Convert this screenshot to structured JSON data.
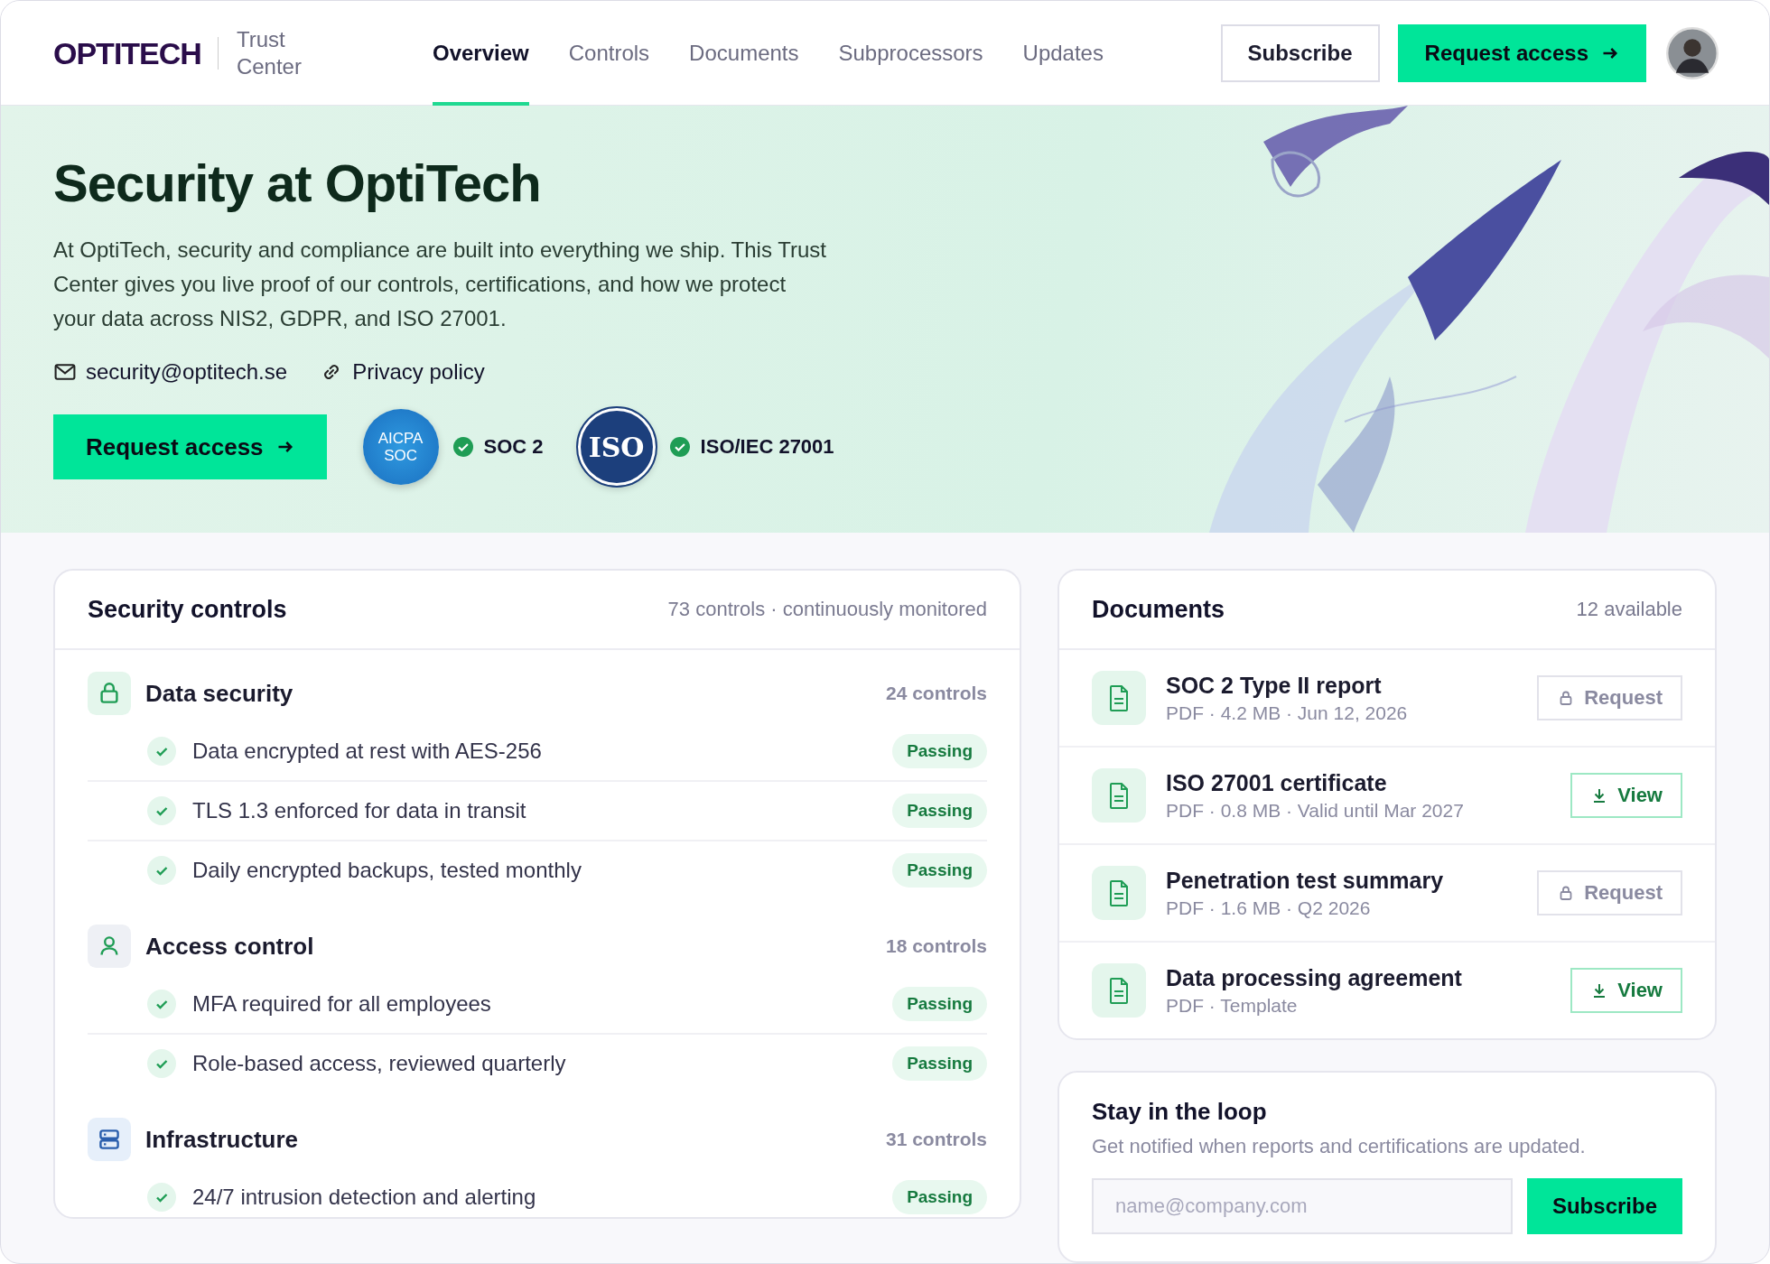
{
  "header": {
    "logo": "OPTITECH",
    "product": "Trust Center",
    "nav": [
      {
        "label": "Overview",
        "selected": true
      },
      {
        "label": "Controls",
        "selected": false
      },
      {
        "label": "Documents",
        "selected": false
      },
      {
        "label": "Subprocessors",
        "selected": false
      },
      {
        "label": "Updates",
        "selected": false
      }
    ],
    "subscribe": "Subscribe",
    "request": "Request access"
  },
  "hero": {
    "title": "Security at OptiTech",
    "description": "At OptiTech, security and compliance are built into everything we ship. This Trust Center gives you live proof of our controls, certifications, and how we protect your data across NIS2, GDPR, and ISO 27001.",
    "contacts": [
      {
        "kind": "email",
        "text": "security@optitech.se"
      },
      {
        "kind": "link",
        "text": "Privacy policy"
      }
    ],
    "cta": "Request access",
    "certifications": [
      {
        "kind": "soc",
        "logo_lines": [
          "AICPA",
          "SOC"
        ],
        "label": "SOC 2",
        "verified": true
      },
      {
        "kind": "iso",
        "logo_lines": [
          "ISO"
        ],
        "label": "ISO/IEC 27001",
        "verified": true
      }
    ]
  },
  "controls": {
    "title": "Security controls",
    "summary": "73 controls · continuously monitored",
    "groups": [
      {
        "kind": "lock",
        "name": "Data security",
        "count": "24 controls",
        "items": [
          {
            "text": "Data encrypted at rest with AES-256",
            "status": "Passing",
            "passing": true
          },
          {
            "text": "TLS 1.3 enforced for data in transit",
            "status": "Passing",
            "passing": true
          },
          {
            "text": "Daily encrypted backups, tested monthly",
            "status": "Passing",
            "passing": true
          }
        ]
      },
      {
        "kind": "user",
        "name": "Access control",
        "count": "18 controls",
        "items": [
          {
            "text": "MFA required for all employees",
            "status": "Passing",
            "passing": true
          },
          {
            "text": "Role-based access, reviewed quarterly",
            "status": "Passing",
            "passing": true
          }
        ]
      },
      {
        "kind": "server",
        "name": "Infrastructure",
        "count": "31 controls",
        "items": [
          {
            "text": "24/7 intrusion detection and alerting",
            "status": "Passing",
            "passing": true
          }
        ]
      }
    ]
  },
  "documents": {
    "title": "Documents",
    "count": "12 available",
    "items": [
      {
        "name": "SOC 2 Type II report",
        "meta": "PDF · 4.2 MB · Jun 12, 2026",
        "action": {
          "kind": "request",
          "label": "Request"
        }
      },
      {
        "name": "ISO 27001 certificate",
        "meta": "PDF · 0.8 MB · Valid until Mar 2027",
        "action": {
          "kind": "view",
          "label": "View"
        }
      },
      {
        "name": "Penetration test summary",
        "meta": "PDF · 1.6 MB · Q2 2026",
        "action": {
          "kind": "request",
          "label": "Request"
        }
      },
      {
        "name": "Data processing agreement",
        "meta": "PDF · Template",
        "action": {
          "kind": "view",
          "label": "View"
        }
      }
    ]
  },
  "newsletter": {
    "title": "Stay in the loop",
    "text": "Get notified when reports and certifications are updated.",
    "placeholder": "name@company.com",
    "button": "Subscribe"
  }
}
